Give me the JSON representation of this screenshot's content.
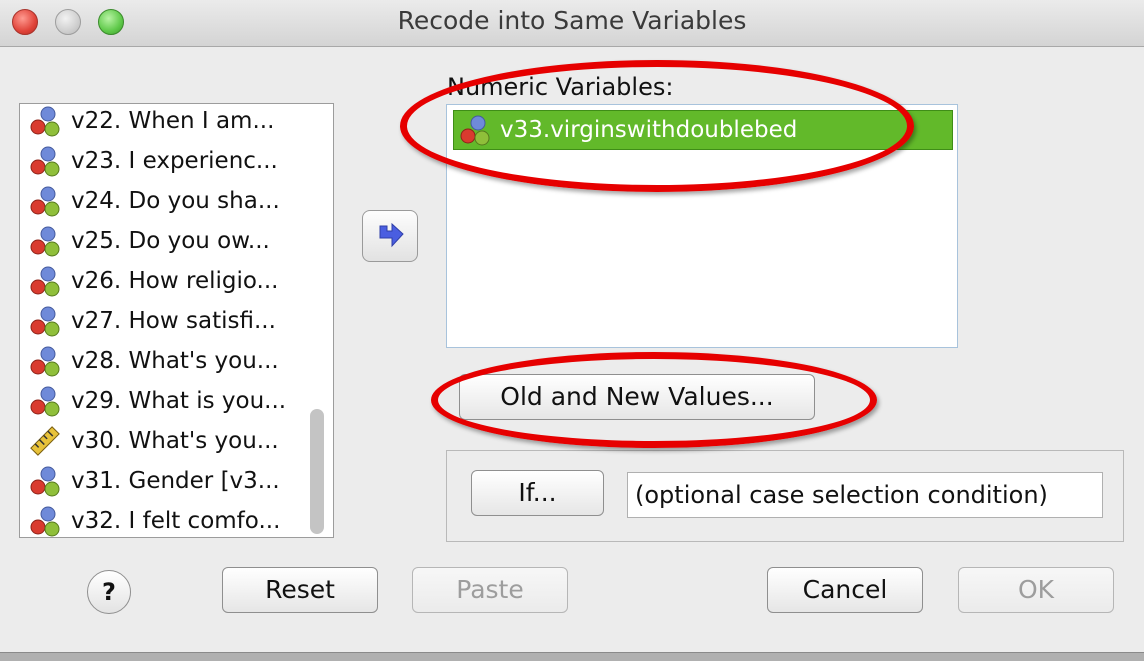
{
  "window": {
    "title": "Recode into Same Variables"
  },
  "variable_list": {
    "items": [
      {
        "label": "v22. When I am...",
        "icon": "nominal-icon"
      },
      {
        "label": "v23. I experienc...",
        "icon": "nominal-icon"
      },
      {
        "label": "v24. Do you sha...",
        "icon": "nominal-icon"
      },
      {
        "label": "v25. Do you ow...",
        "icon": "nominal-icon"
      },
      {
        "label": "v26. How religio...",
        "icon": "nominal-icon"
      },
      {
        "label": "v27. How satisfi...",
        "icon": "nominal-icon"
      },
      {
        "label": "v28. What's you...",
        "icon": "nominal-icon"
      },
      {
        "label": "v29. What is you...",
        "icon": "nominal-icon"
      },
      {
        "label": "v30. What's you...",
        "icon": "scale-icon"
      },
      {
        "label": "v31. Gender [v3...",
        "icon": "nominal-icon"
      },
      {
        "label": "v32. I felt comfo...",
        "icon": "nominal-icon"
      }
    ]
  },
  "numeric_variables": {
    "label": "Numeric Variables:",
    "items": [
      {
        "label": "v33.virginswithdoublebed",
        "icon": "nominal-icon",
        "selected": true
      }
    ]
  },
  "buttons": {
    "old_new": "Old and New Values...",
    "if": "If...",
    "reset": "Reset",
    "paste": "Paste",
    "cancel": "Cancel",
    "ok": "OK",
    "help": "?"
  },
  "condition": {
    "value": "(optional case selection condition)"
  },
  "colors": {
    "selection": "#62b92a",
    "annotation": "#e60000"
  }
}
